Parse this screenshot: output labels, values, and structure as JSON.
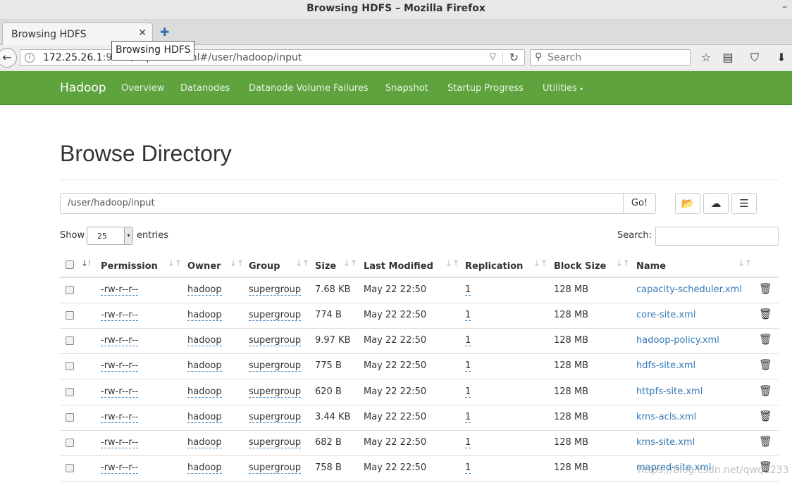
{
  "window": {
    "title": "Browsing HDFS – Mozilla Firefox",
    "minimize": "–"
  },
  "tabs": [
    {
      "label": "Browsing HDFS",
      "close": "✕"
    }
  ],
  "tooltip": "Browsing HDFS",
  "urlbar": {
    "host": "172.25.26.1",
    "rest": ":9870/explorer.html#/user/hadoop/input"
  },
  "search": {
    "placeholder": "Search"
  },
  "hadoop_nav": {
    "brand": "Hadoop",
    "links": [
      "Overview",
      "Datanodes",
      "Datanode Volume Failures",
      "Snapshot",
      "Startup Progress",
      "Utilities"
    ]
  },
  "page": {
    "title": "Browse Directory",
    "path_value": "/user/hadoop/input",
    "go_label": "Go!",
    "show_label": "Show",
    "entries_value": "25",
    "entries_label": "entries",
    "search_label": "Search:"
  },
  "table": {
    "columns": [
      "Permission",
      "Owner",
      "Group",
      "Size",
      "Last Modified",
      "Replication",
      "Block Size",
      "Name"
    ],
    "rows": [
      [
        "-rw-r--r--",
        "hadoop",
        "supergroup",
        "7.68 KB",
        "May 22 22:50",
        "1",
        "128 MB",
        "capacity-scheduler.xml"
      ],
      [
        "-rw-r--r--",
        "hadoop",
        "supergroup",
        "774 B",
        "May 22 22:50",
        "1",
        "128 MB",
        "core-site.xml"
      ],
      [
        "-rw-r--r--",
        "hadoop",
        "supergroup",
        "9.97 KB",
        "May 22 22:50",
        "1",
        "128 MB",
        "hadoop-policy.xml"
      ],
      [
        "-rw-r--r--",
        "hadoop",
        "supergroup",
        "775 B",
        "May 22 22:50",
        "1",
        "128 MB",
        "hdfs-site.xml"
      ],
      [
        "-rw-r--r--",
        "hadoop",
        "supergroup",
        "620 B",
        "May 22 22:50",
        "1",
        "128 MB",
        "httpfs-site.xml"
      ],
      [
        "-rw-r--r--",
        "hadoop",
        "supergroup",
        "3.44 KB",
        "May 22 22:50",
        "1",
        "128 MB",
        "kms-acls.xml"
      ],
      [
        "-rw-r--r--",
        "hadoop",
        "supergroup",
        "682 B",
        "May 22 22:50",
        "1",
        "128 MB",
        "kms-site.xml"
      ],
      [
        "-rw-r--r--",
        "hadoop",
        "supergroup",
        "758 B",
        "May 22 22:50",
        "1",
        "128 MB",
        "mapred-site.xml"
      ]
    ]
  },
  "watermark": "https://blog.csdn.net/qwq1233",
  "colors": {
    "hadoop_green": "#5fa33e",
    "link": "#337ab7"
  }
}
